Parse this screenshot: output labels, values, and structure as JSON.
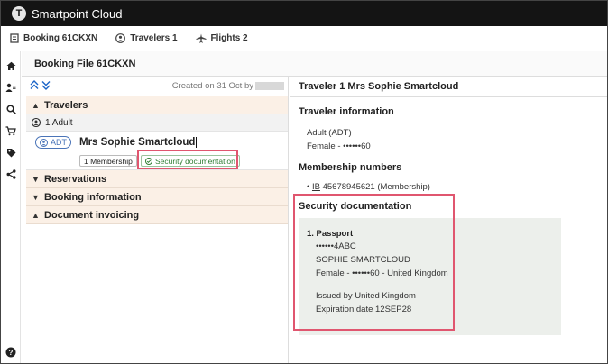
{
  "app": {
    "title": "Smartpoint Cloud",
    "logo_letter": "T"
  },
  "tabs": [
    {
      "label": "Booking 61CKXN",
      "icon": "booking-icon"
    },
    {
      "label": "Travelers 1",
      "icon": "person-icon"
    },
    {
      "label": "Flights 2",
      "icon": "plane-icon"
    }
  ],
  "rail_icons": [
    "home-icon",
    "travelers-icon",
    "search-icon",
    "cart-icon",
    "tag-icon",
    "share-icon",
    "help-icon"
  ],
  "booking_file": {
    "title": "Booking File 61CKXN",
    "created": "Created on 31 Oct by"
  },
  "left": {
    "sections": {
      "travelers": "Travelers",
      "reservations": "Reservations",
      "booking_information": "Booking information",
      "document_invoicing": "Document invoicing"
    },
    "adult_count": "1 Adult",
    "traveler": {
      "type": "ADT",
      "name": "Mrs Sophie Smartcloud",
      "membership_pill": "1 Membership",
      "security_pill": "Security documentation"
    }
  },
  "right": {
    "title": "Traveler 1 Mrs Sophie Smartcloud",
    "traveler_info": {
      "heading": "Traveler information",
      "type": "Adult (ADT)",
      "gender": "Female",
      "sep": "-",
      "dob": "••••••60"
    },
    "membership": {
      "heading": "Membership numbers",
      "airline": "IB",
      "number": "45678945621 (Membership)"
    },
    "security": {
      "heading": "Security documentation",
      "doc_title": "1. Passport",
      "doc_number": "••••••4ABC",
      "name": "SOPHIE SMARTCLOUD",
      "gender": "Female",
      "sep1": "-",
      "dob": "••••••60",
      "sep2": "-",
      "nationality": "United Kingdom",
      "issued": "Issued by United Kingdom",
      "expiration": "Expiration date 12SEP28"
    }
  },
  "colors": {
    "topbar": "#141414",
    "section_bg": "#fbf0e6",
    "highlight": "#e0566f",
    "card_bg": "#ecefeb",
    "link": "#1a64c8"
  }
}
